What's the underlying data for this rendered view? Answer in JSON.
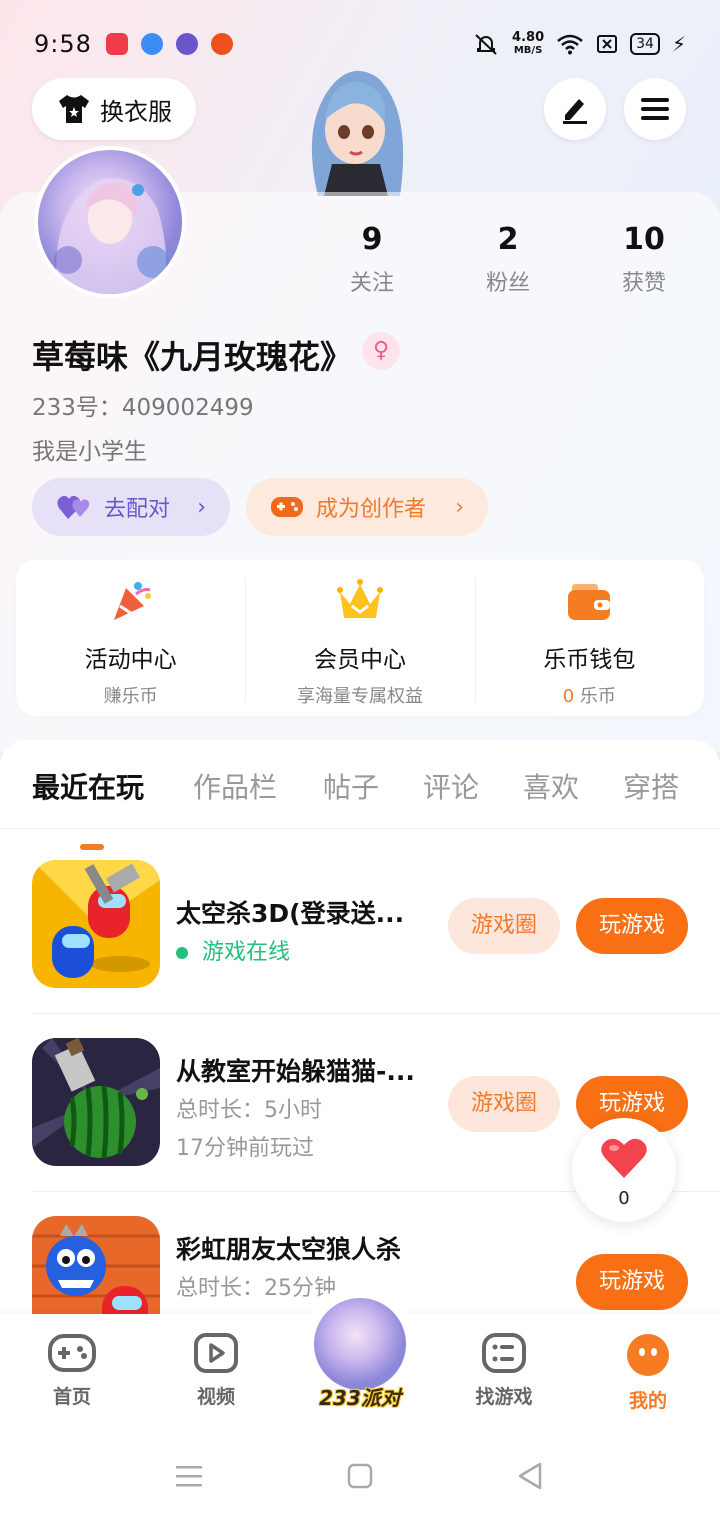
{
  "status_bar": {
    "time": "9:58",
    "net_speed_value": "4.80",
    "net_speed_unit": "MB/S",
    "battery": "34"
  },
  "header": {
    "outfit_label": "换衣服"
  },
  "profile": {
    "name": "草莓味《九月玫瑰花》",
    "gender_symbol": "♀",
    "uid": "233号：409002499",
    "bio": "我是小学生",
    "stats": [
      {
        "value": "9",
        "label": "关注"
      },
      {
        "value": "2",
        "label": "粉丝"
      },
      {
        "value": "10",
        "label": "获赞"
      }
    ],
    "match_label": "去配对",
    "creator_label": "成为创作者"
  },
  "services": [
    {
      "title": "活动中心",
      "sub": "赚乐币",
      "icon": "party-icon"
    },
    {
      "title": "会员中心",
      "sub": "享海量专属权益",
      "icon": "crown-icon"
    },
    {
      "title": "乐币钱包",
      "sub_value": "0",
      "sub_unit": "乐币",
      "icon": "wallet-icon"
    }
  ],
  "tabs": [
    "最近在玩",
    "作品栏",
    "帖子",
    "评论",
    "喜欢",
    "穿搭"
  ],
  "games": [
    {
      "title": "太空杀3D(登录送...",
      "status": "游戏在线",
      "circle_label": "游戏圈",
      "play_label": "玩游戏"
    },
    {
      "title": "从教室开始躲猫猫-...",
      "line1": "总时长：5小时",
      "line2": "17分钟前玩过",
      "circle_label": "游戏圈",
      "play_label": "玩游戏"
    },
    {
      "title": "彩虹朋友太空狼人杀",
      "line1": "总时长：25分钟",
      "play_label": "玩游戏"
    }
  ],
  "like": {
    "count": "0"
  },
  "bottom_nav": {
    "items": [
      "首页",
      "视频",
      "找游戏",
      "我的"
    ],
    "center_label": "233派对"
  },
  "colors": {
    "accent": "#f57c22",
    "play_button": "#f86f14",
    "online": "#22c07a",
    "match_purple": "#6a57c8"
  }
}
